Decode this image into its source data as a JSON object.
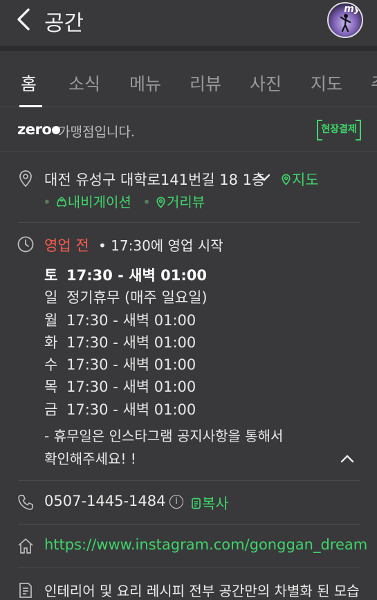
{
  "header": {
    "title": "공간",
    "avatar_label": "my"
  },
  "tabs": [
    "홈",
    "소식",
    "메뉴",
    "리뷰",
    "사진",
    "지도",
    "주"
  ],
  "zero_pay": {
    "logo": "zero",
    "text": "가맹점입니다.",
    "badge": "현장결제"
  },
  "address": {
    "text": "대전 유성구 대학로141번길 18 1층",
    "map_link": "지도",
    "navigation_link": "내비게이션",
    "street_view_link": "거리뷰"
  },
  "hours": {
    "status": "영업 전",
    "status_detail": "• 17:30에 영업 시작",
    "schedule": [
      {
        "day": "토",
        "time": "17:30 - 새벽 01:00"
      },
      {
        "day": "일",
        "time": "정기휴무 (매주 일요일)"
      },
      {
        "day": "월",
        "time": "17:30 - 새벽 01:00"
      },
      {
        "day": "화",
        "time": "17:30 - 새벽 01:00"
      },
      {
        "day": "수",
        "time": "17:30 - 새벽 01:00"
      },
      {
        "day": "목",
        "time": "17:30 - 새벽 01:00"
      },
      {
        "day": "금",
        "time": "17:30 - 새벽 01:00"
      }
    ],
    "note_line1": "- 휴무일은 인스타그램 공지사항을 통해서",
    "note_line2": "확인해주세요! !"
  },
  "phone": {
    "number": "0507-1445-1484",
    "copy_label": "복사"
  },
  "website": {
    "url": "https://www.instagram.com/gonggan_dream"
  },
  "description": {
    "text": "인테리어 및 요리 레시피 전부 공간만의 차별화 된 모습"
  },
  "colors": {
    "accent_green": "#3fd46a",
    "status_red": "#ff5a4f",
    "background": "#39393b"
  }
}
